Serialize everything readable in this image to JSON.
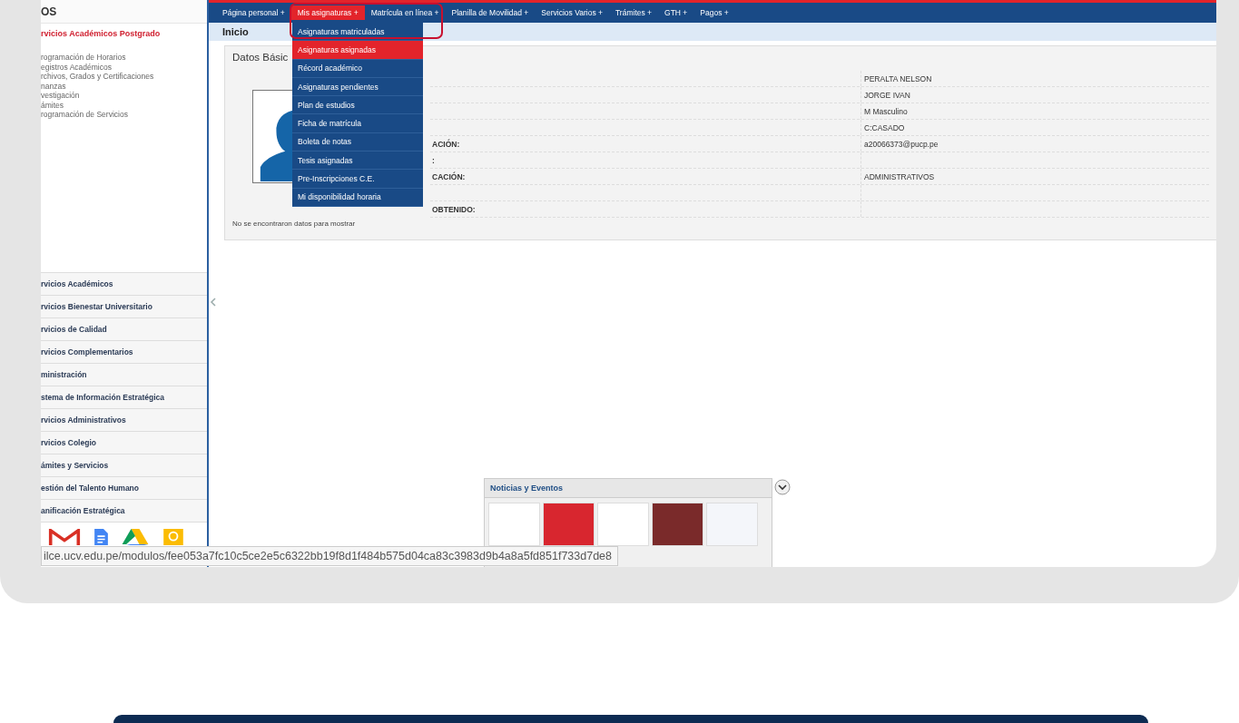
{
  "sidebar": {
    "header": "OS",
    "section_title": "rvicios Académicos Postgrado",
    "links": [
      "rogramación de Horarios",
      "egistros Académicos",
      "rchivos, Grados y Certificaciones",
      "nanzas",
      "vestigación",
      "ámites",
      "rogramación de Servicios"
    ],
    "accordion": [
      "rvicios Académicos",
      "rvicios Bienestar Universitario",
      "rvicios de Calidad",
      "rvicios Complementarios",
      "ministración",
      "stema de Información Estratégica",
      "rvicios Administrativos",
      "rvicios Colegio",
      "ámites y Servicios",
      "estión del Talento Humano",
      "anificación Estratégica"
    ]
  },
  "nav": {
    "items": [
      {
        "label": "Página personal +",
        "selected": false
      },
      {
        "label": "Mis asignaturas +",
        "selected": true
      },
      {
        "label": "Matrícula en línea +",
        "selected": false
      },
      {
        "label": "Planilla de Movilidad +",
        "selected": false
      },
      {
        "label": "Servicios Varios +",
        "selected": false
      },
      {
        "label": "Trámites +",
        "selected": false
      },
      {
        "label": "GTH +",
        "selected": false
      },
      {
        "label": "Pagos +",
        "selected": false
      }
    ]
  },
  "dropdown": {
    "items": [
      {
        "label": "Asignaturas matriculadas",
        "selected": false
      },
      {
        "label": "Asignaturas asignadas",
        "selected": true
      },
      {
        "label": "Récord académico",
        "selected": false
      },
      {
        "label": "Asignaturas pendientes",
        "selected": false
      },
      {
        "label": "Plan de estudios",
        "selected": false
      },
      {
        "label": "Ficha de matrícula",
        "selected": false
      },
      {
        "label": "Boleta de notas",
        "selected": false
      },
      {
        "label": "Tesis asignadas",
        "selected": false
      },
      {
        "label": "Pre-Inscripciones C.E.",
        "selected": false
      },
      {
        "label": "Mi disponibilidad horaria",
        "selected": false
      }
    ]
  },
  "breadcrumb": "Inicio",
  "panel": {
    "title": "Datos Básic",
    "rows": [
      {
        "value": "PERALTA NELSON"
      },
      {
        "value": "JORGE IVAN"
      },
      {
        "value": "M Masculino"
      },
      {
        "value": "C:CASADO"
      },
      {
        "label": "ACIÓN:",
        "value": "a20066373@pucp.pe"
      },
      {
        "label": ":"
      },
      {
        "label": "CACIÓN:",
        "value": "ADMINISTRATIVOS"
      },
      {},
      {
        "label": "OBTENIDO:"
      }
    ],
    "empty_message": "No se encontraron datos para mostrar"
  },
  "news": {
    "title": "Noticias y Eventos"
  },
  "status_url": "ilce.ucv.edu.pe/modulos/fee053a7fc10c5ce2e5c6322bb19f8d1f484b575d04ca83c3983d9b4a8a5fd851f733d7de8"
}
